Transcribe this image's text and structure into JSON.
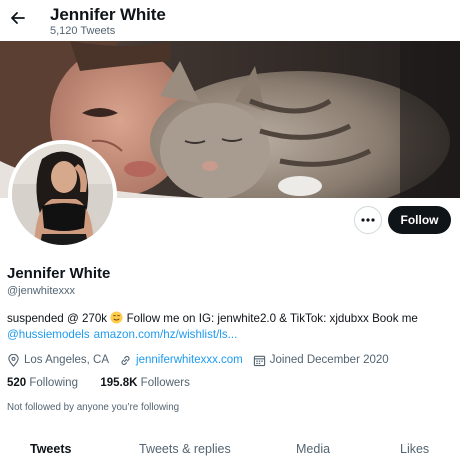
{
  "header": {
    "title": "Jennifer White",
    "tweet_count": "5,120 Tweets"
  },
  "profile": {
    "name": "Jennifer White",
    "handle": "@jenwhitexxx",
    "bio_line1_a": "suspended @ 270k",
    "bio_line1_b": "Follow me on IG: jenwhite2.0 & TikTok: xjdubxx Book me",
    "bio_mention": "@hussiemodels",
    "bio_link": "amazon.com/hz/wishlist/ls...",
    "location": "Los Angeles, CA",
    "website": "jenniferwhitexxx.com",
    "joined": "Joined December 2020",
    "following_count": "520",
    "following_label": "Following",
    "followers_count": "195.8K",
    "followers_label": "Followers",
    "not_followed_text": "Not followed by anyone you’re following"
  },
  "actions": {
    "follow_label": "Follow",
    "more_icon": "more-horizontal-icon"
  },
  "tabs": [
    {
      "label": "Tweets",
      "active": true
    },
    {
      "label": "Tweets & replies",
      "active": false
    },
    {
      "label": "Media",
      "active": false
    },
    {
      "label": "Likes",
      "active": false
    }
  ],
  "colors": {
    "accent": "#1d9bf0",
    "text": "#0f1419",
    "secondary": "#536471",
    "follow_button": "#0f1419"
  }
}
